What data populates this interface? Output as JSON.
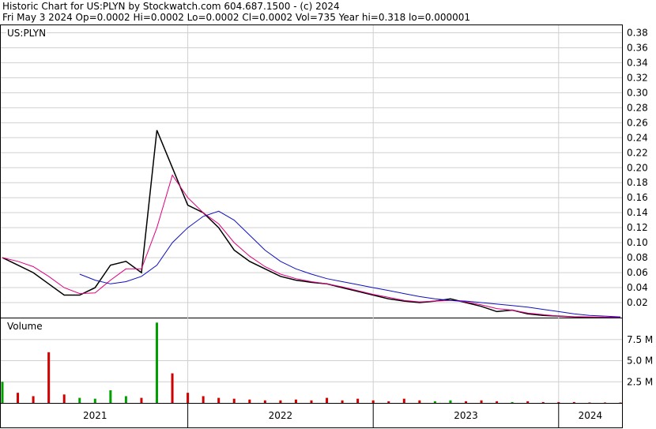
{
  "header": {
    "line1": "Historic Chart for US:PLYN by Stockwatch.com 604.687.1500 - (c) 2024",
    "line2": "Fri May  3 2024   Op=0.0002  Hi=0.0002  Lo=0.0002  Cl=0.0002  Vol=735   Year hi=0.318   lo=0.000001"
  },
  "price_panel_label": "US:PLYN",
  "volume_panel_label": "Volume",
  "colors": {
    "price": "#000000",
    "ma_short": "#e0007f",
    "ma_long": "#1010c0",
    "volume_up": "#00a000",
    "volume_down": "#d00000",
    "grid": "#d0d0d0"
  },
  "chart_data": [
    {
      "type": "line",
      "x": [
        "2021-01",
        "2021-02",
        "2021-03",
        "2021-04",
        "2021-05",
        "2021-06",
        "2021-07",
        "2021-08",
        "2021-09",
        "2021-10",
        "2021-11",
        "2021-12",
        "2022-01",
        "2022-02",
        "2022-03",
        "2022-04",
        "2022-05",
        "2022-06",
        "2022-07",
        "2022-08",
        "2022-09",
        "2022-10",
        "2022-11",
        "2022-12",
        "2023-01",
        "2023-02",
        "2023-03",
        "2023-04",
        "2023-05",
        "2023-06",
        "2023-07",
        "2023-08",
        "2023-09",
        "2023-10",
        "2023-11",
        "2023-12",
        "2024-01",
        "2024-02",
        "2024-03",
        "2024-04",
        "2024-05"
      ],
      "series": [
        {
          "values": [
            0.08,
            0.07,
            0.06,
            0.045,
            0.03,
            0.03,
            0.04,
            0.07,
            0.075,
            0.06,
            0.25,
            0.2,
            0.15,
            0.14,
            0.12,
            0.09,
            0.075,
            0.065,
            0.055,
            0.05,
            0.047,
            0.045,
            0.04,
            0.035,
            0.03,
            0.025,
            0.022,
            0.02,
            0.022,
            0.025,
            0.02,
            0.015,
            0.008,
            0.01,
            0.005,
            0.003,
            0.002,
            0.001,
            0.0005,
            0.0003,
            0.0002
          ]
        },
        {
          "values": [
            0.08,
            0.075,
            0.068,
            0.055,
            0.04,
            0.032,
            0.033,
            0.05,
            0.065,
            0.065,
            0.12,
            0.19,
            0.16,
            0.14,
            0.125,
            0.1,
            0.082,
            0.068,
            0.058,
            0.052,
            0.048,
            0.045,
            0.041,
            0.036,
            0.031,
            0.027,
            0.023,
            0.021,
            0.022,
            0.023,
            0.021,
            0.017,
            0.012,
            0.01,
            0.006,
            0.004,
            0.002,
            0.001,
            0.0006,
            0.0004,
            0.0003
          ]
        },
        {
          "values": [
            null,
            null,
            null,
            null,
            null,
            0.058,
            0.05,
            0.045,
            0.048,
            0.055,
            0.07,
            0.1,
            0.12,
            0.135,
            0.142,
            0.13,
            0.11,
            0.09,
            0.075,
            0.065,
            0.058,
            0.052,
            0.048,
            0.044,
            0.04,
            0.036,
            0.032,
            0.028,
            0.025,
            0.023,
            0.022,
            0.02,
            0.018,
            0.016,
            0.014,
            0.011,
            0.008,
            0.005,
            0.003,
            0.002,
            0.001
          ]
        }
      ],
      "yticks": [
        "0.02",
        "0.04",
        "0.06",
        "0.08",
        "0.10",
        "0.12",
        "0.14",
        "0.16",
        "0.18",
        "0.20",
        "0.22",
        "0.24",
        "0.26",
        "0.28",
        "0.30",
        "0.32",
        "0.34",
        "0.36",
        "0.38"
      ],
      "ylim": [
        0,
        0.39
      ],
      "grid": true
    },
    {
      "type": "bar",
      "x": [
        "2021-01",
        "2021-02",
        "2021-03",
        "2021-04",
        "2021-05",
        "2021-06",
        "2021-07",
        "2021-08",
        "2021-09",
        "2021-10",
        "2021-11",
        "2021-12",
        "2022-01",
        "2022-02",
        "2022-03",
        "2022-04",
        "2022-05",
        "2022-06",
        "2022-07",
        "2022-08",
        "2022-09",
        "2022-10",
        "2022-11",
        "2022-12",
        "2023-01",
        "2023-02",
        "2023-03",
        "2023-04",
        "2023-05",
        "2023-06",
        "2023-07",
        "2023-08",
        "2023-09",
        "2023-10",
        "2023-11",
        "2023-12",
        "2024-01",
        "2024-02",
        "2024-03",
        "2024-04",
        "2024-05"
      ],
      "series": [
        {
          "values": [
            2.5,
            1.2,
            0.8,
            6.0,
            1.0,
            0.6,
            0.5,
            1.5,
            0.8,
            0.6,
            9.5,
            3.5,
            1.2,
            0.8,
            0.6,
            0.5,
            0.4,
            0.3,
            0.3,
            0.4,
            0.3,
            0.6,
            0.3,
            0.5,
            0.3,
            0.2,
            0.5,
            0.3,
            0.2,
            0.3,
            0.2,
            0.3,
            0.2,
            0.1,
            0.2,
            0.1,
            0.1,
            0.1,
            0.05,
            0.05,
            0.05
          ]
        }
      ],
      "yticks": [
        "2.5 M",
        "5.0 M",
        "7.5 M"
      ],
      "ylim": [
        0,
        10
      ],
      "grid": true
    }
  ],
  "x_axis": {
    "years": [
      "2021",
      "2022",
      "2023",
      "2024"
    ]
  }
}
